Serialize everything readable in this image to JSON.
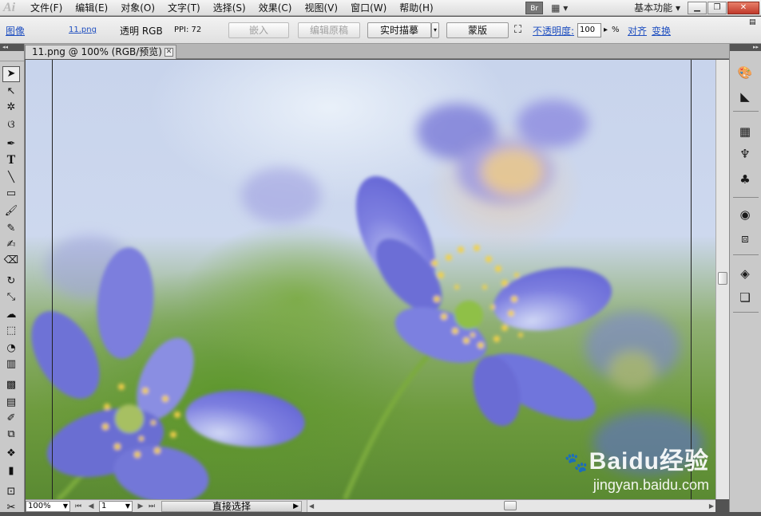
{
  "app": {
    "logo": "Ai",
    "menu": [
      {
        "label": "文件(F)"
      },
      {
        "label": "编辑(E)"
      },
      {
        "label": "对象(O)"
      },
      {
        "label": "文字(T)"
      },
      {
        "label": "选择(S)"
      },
      {
        "label": "效果(C)"
      },
      {
        "label": "视图(V)"
      },
      {
        "label": "窗口(W)"
      },
      {
        "label": "帮助(H)"
      }
    ],
    "bridge_label": "Br",
    "arrange_icon": "arrange-documents-icon",
    "workspace_label": "基本功能",
    "window_controls": [
      "minimize",
      "restore",
      "close"
    ]
  },
  "control_bar": {
    "object_type": "图像",
    "file_name": "11.png",
    "color_mode": "透明 RGB",
    "ppi": "PPI: 72",
    "embed_label": "嵌入",
    "edit_original_label": "编辑原稿",
    "live_trace_label": "实时描摹",
    "mask_label": "蒙版",
    "opacity_label": "不透明度:",
    "opacity_value": "100",
    "opacity_unit": "%",
    "align_label": "对齐",
    "transform_label": "变换"
  },
  "document": {
    "tab_title": "11.png @ 100% (RGB/预览)"
  },
  "tools": [
    "selection-tool-icon",
    "direct-selection-tool-icon",
    "magic-wand-tool-icon",
    "lasso-tool-icon",
    "pen-tool-icon",
    "type-tool-icon",
    "line-tool-icon",
    "rectangle-tool-icon",
    "paintbrush-tool-icon",
    "pencil-tool-icon",
    "blob-brush-tool-icon",
    "eraser-tool-icon",
    "rotate-tool-icon",
    "scale-tool-icon",
    "warp-tool-icon",
    "free-transform-tool-icon",
    "shape-builder-tool-icon",
    "perspective-grid-tool-icon",
    "mesh-tool-icon",
    "gradient-tool-icon",
    "eyedropper-tool-icon",
    "blend-tool-icon",
    "symbol-sprayer-tool-icon",
    "column-graph-tool-icon",
    "artboard-tool-icon",
    "slice-tool-icon"
  ],
  "right_panels": [
    "color-panel-icon",
    "color-guide-icon",
    "swatches-panel-icon",
    "brushes-panel-icon",
    "symbols-panel-icon",
    "appearance-panel-icon",
    "graphic-styles-icon",
    "layers-panel-icon",
    "artboards-panel-icon"
  ],
  "status_bar": {
    "zoom": "100%",
    "page": "1",
    "current_tool": "直接选择"
  },
  "watermark": {
    "brand": "Baidu经验",
    "url": "jingyan.baidu.com"
  }
}
